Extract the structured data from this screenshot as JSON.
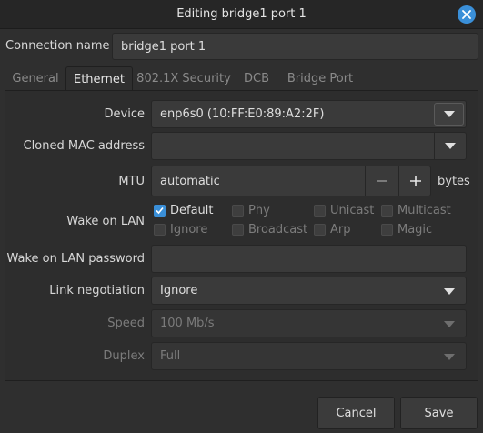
{
  "window": {
    "title": "Editing bridge1 port 1"
  },
  "connection": {
    "label": "Connection name",
    "value": "bridge1 port 1"
  },
  "tabs": [
    {
      "label": "General",
      "active": false
    },
    {
      "label": "Ethernet",
      "active": true
    },
    {
      "label": "802.1X Security",
      "active": false
    },
    {
      "label": "DCB",
      "active": false
    },
    {
      "label": "Bridge Port",
      "active": false
    }
  ],
  "ethernet": {
    "device": {
      "label": "Device",
      "value": "enp6s0 (10:FF:E0:89:A2:2F)"
    },
    "cloned_mac": {
      "label": "Cloned MAC address",
      "value": ""
    },
    "mtu": {
      "label": "MTU",
      "value": "automatic",
      "unit": "bytes"
    },
    "wol": {
      "label": "Wake on LAN",
      "options": [
        {
          "label": "Default",
          "checked": true
        },
        {
          "label": "Phy",
          "checked": false
        },
        {
          "label": "Unicast",
          "checked": false
        },
        {
          "label": "Multicast",
          "checked": false
        },
        {
          "label": "Ignore",
          "checked": false
        },
        {
          "label": "Broadcast",
          "checked": false
        },
        {
          "label": "Arp",
          "checked": false
        },
        {
          "label": "Magic",
          "checked": false
        }
      ]
    },
    "wol_password": {
      "label": "Wake on LAN password",
      "value": ""
    },
    "link_negotiation": {
      "label": "Link negotiation",
      "value": "Ignore"
    },
    "speed": {
      "label": "Speed",
      "value": "100 Mb/s"
    },
    "duplex": {
      "label": "Duplex",
      "value": "Full"
    }
  },
  "buttons": {
    "cancel": "Cancel",
    "save": "Save"
  },
  "colors": {
    "accent": "#3a8fd8",
    "background": "#2f2f2f"
  }
}
